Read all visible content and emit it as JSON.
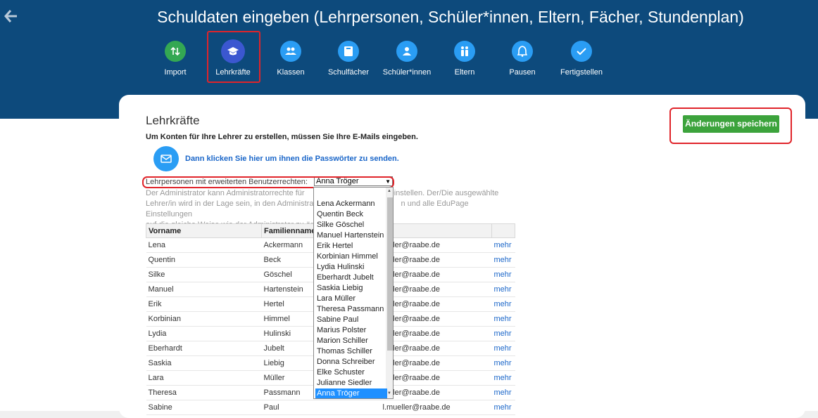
{
  "header": {
    "title": "Schuldaten eingeben (Lehrpersonen, Schüler*innen, Eltern, Fächer, Stundenplan)"
  },
  "steps": [
    {
      "label": "Import"
    },
    {
      "label": "Lehrkräfte"
    },
    {
      "label": "Klassen"
    },
    {
      "label": "Schulfächer"
    },
    {
      "label": "Schüler*innen"
    },
    {
      "label": "Eltern"
    },
    {
      "label": "Pausen"
    },
    {
      "label": "Fertigstellen"
    }
  ],
  "page": {
    "heading": "Lehrkräfte",
    "subtitle": "Um Konten für Ihre Lehrer zu erstellen, müssen Sie Ihre E-Mails eingeben.",
    "send_link": "Dann klicken Sie hier um ihnen die Passwörter zu senden.",
    "save_label": "Änderungen speichern",
    "admin_label": "Lehrpersonen mit erweiterten Benutzerrechten:",
    "admin_selected": "Anna Tröger",
    "desc_line1": "Der Administrator kann Administratorrechte für",
    "desc_line1b": "einstellen. Der/Die ausgewählte",
    "desc_line2": "Lehrer/in wird in der Lage sein, in den Administrat",
    "desc_line2b": "n und alle EduPage Einstellungen",
    "desc_line3": "auf die gleiche Weise wie der Administrator zu än"
  },
  "table": {
    "headers": [
      "Vorname",
      "Familienname",
      "ail",
      ""
    ],
    "rows": [
      [
        "Lena",
        "Ackermann",
        "ueller@raabe.de",
        "mehr"
      ],
      [
        "Quentin",
        "Beck",
        "ueller@raabe.de",
        "mehr"
      ],
      [
        "Silke",
        "Göschel",
        "ueller@raabe.de",
        "mehr"
      ],
      [
        "Manuel",
        "Hartenstein",
        "ueller@raabe.de",
        "mehr"
      ],
      [
        "Erik",
        "Hertel",
        "ueller@raabe.de",
        "mehr"
      ],
      [
        "Korbinian",
        "Himmel",
        "ueller@raabe.de",
        "mehr"
      ],
      [
        "Lydia",
        "Hulinski",
        "ueller@raabe.de",
        "mehr"
      ],
      [
        "Eberhardt",
        "Jubelt",
        "ueller@raabe.de",
        "mehr"
      ],
      [
        "Saskia",
        "Liebig",
        "ueller@raabe.de",
        "mehr"
      ],
      [
        "Lara",
        "Müller",
        "ueller@raabe.de",
        "mehr"
      ],
      [
        "Theresa",
        "Passmann",
        "ueller@raabe.de",
        "mehr"
      ],
      [
        "Sabine",
        "Paul",
        "l.mueller@raabe.de",
        "mehr"
      ]
    ]
  },
  "dropdown": [
    "Lena Ackermann",
    "Quentin Beck",
    "Silke Göschel",
    "Manuel Hartenstein",
    "Erik Hertel",
    "Korbinian Himmel",
    "Lydia Hulinski",
    "Eberhardt Jubelt",
    "Saskia Liebig",
    "Lara Müller",
    "Theresa Passmann",
    "Sabine Paul",
    "Marius Polster",
    "Marion Schiller",
    "Thomas Schiller",
    "Donna Schreiber",
    "Elke Schuster",
    "Julianne Siedler",
    "Anna Tröger"
  ]
}
